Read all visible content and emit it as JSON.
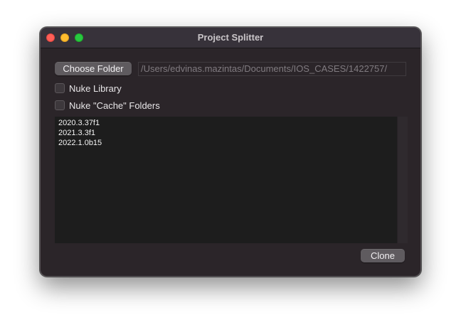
{
  "window": {
    "title": "Project Splitter",
    "traffic_lights": {
      "close": "#ff5f57",
      "minimize": "#febc2e",
      "zoom": "#28c840"
    }
  },
  "toolbar": {
    "choose_folder_label": "Choose Folder",
    "path_value": "/Users/edvinas.mazintas/Documents/IOS_CASES/1422757/"
  },
  "options": {
    "nuke_library_label": "Nuke Library",
    "nuke_library_checked": false,
    "nuke_cache_label": "Nuke \"Cache\" Folders",
    "nuke_cache_checked": false
  },
  "versions": [
    "2020.3.37f1",
    "2021.3.3f1",
    "2022.1.0b15"
  ],
  "footer": {
    "clone_label": "Clone"
  }
}
